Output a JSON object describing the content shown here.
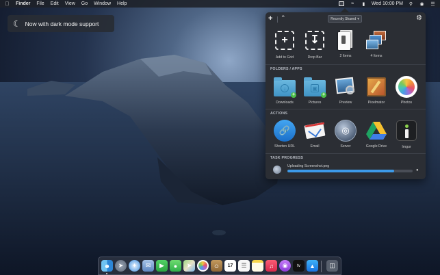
{
  "menubar": {
    "app_name": "Finder",
    "menus": [
      "File",
      "Edit",
      "View",
      "Go",
      "Window",
      "Help"
    ],
    "clock": "Wed 10:00 PM"
  },
  "toast": {
    "text": "Now with dark mode support"
  },
  "panel": {
    "dropdown_label": "Recently Shared",
    "top_tiles": [
      {
        "label": "Add to Grid",
        "icon": "add-grid-icon"
      },
      {
        "label": "Drop Bar",
        "icon": "drop-bar-icon"
      },
      {
        "label": "2 Items",
        "icon": "files-stack-icon"
      },
      {
        "label": "4 Items",
        "icon": "photos-stack-icon"
      }
    ],
    "folders_header": "FOLDERS / APPS",
    "folders": [
      {
        "label": "Downloads",
        "icon": "downloads-folder-icon"
      },
      {
        "label": "Pictures",
        "icon": "pictures-folder-icon"
      },
      {
        "label": "Preview",
        "icon": "preview-app-icon"
      },
      {
        "label": "Pixelmator",
        "icon": "pixelmator-app-icon"
      },
      {
        "label": "Photos",
        "icon": "photos-app-icon"
      }
    ],
    "actions_header": "ACTIONS",
    "actions": [
      {
        "label": "Shorten URL",
        "icon": "link-icon"
      },
      {
        "label": "Email",
        "icon": "email-icon"
      },
      {
        "label": "Server",
        "icon": "server-icon"
      },
      {
        "label": "Google Drive",
        "icon": "google-drive-icon"
      },
      {
        "label": "Imgur",
        "icon": "imgur-icon"
      }
    ],
    "task_header": "TASK PROGRESS",
    "task": {
      "label": "Uploading Screenshot.png",
      "progress": 0.85
    }
  },
  "dock": {
    "apps": [
      "finder-icon",
      "launchpad-icon",
      "safari-icon",
      "mail-icon",
      "facetime-icon",
      "messages-icon",
      "maps-icon",
      "photos-icon",
      "contacts-icon",
      "calendar-icon",
      "reminders-icon",
      "notes-icon",
      "music-icon",
      "podcasts-icon",
      "tv-icon",
      "app-store-icon",
      "trash-icon"
    ],
    "calendar_day": "17",
    "tv_label": "tv"
  },
  "colors": {
    "panel_bg": "#2b2e34",
    "progress_fill": "#3d9ae8",
    "menubar_bg": "#1e2128"
  }
}
